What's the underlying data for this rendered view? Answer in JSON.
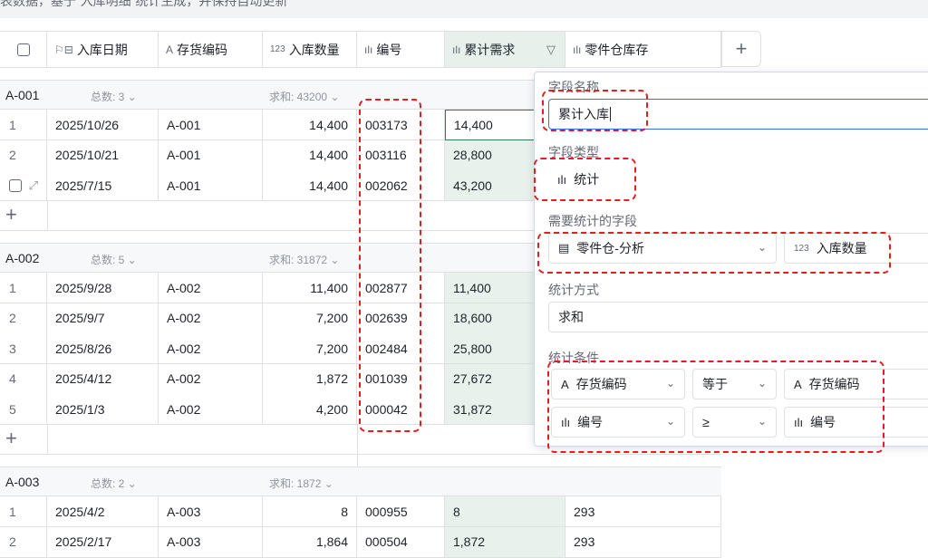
{
  "topbar": {
    "text": "表数据，基于“入库明细”统计生成，并保持自动更新"
  },
  "columns": [
    {
      "icon": "☐",
      "label": ""
    },
    {
      "icon": "⚐⧉",
      "label": "入库日期"
    },
    {
      "icon": "A̧",
      "label": "存货编码"
    },
    {
      "icon": "¹²³",
      "label": "入库数量"
    },
    {
      "icon": "ılı",
      "label": "编号"
    },
    {
      "icon": "ılı",
      "label": "累计需求",
      "filter": "⛉"
    },
    {
      "icon": "ılı",
      "label": "零件仓库存"
    }
  ],
  "add_column": "+",
  "groups": [
    {
      "title": "A-001",
      "count_label": "总数: 3",
      "sum_label": "求和: 43200",
      "rows": [
        {
          "idx": "1",
          "date": "2025/10/26",
          "code": "A-001",
          "qty": "14,400",
          "no": "003173",
          "cum": "14,400",
          "stock": ""
        },
        {
          "idx": "2",
          "date": "2025/10/21",
          "code": "A-001",
          "qty": "14,400",
          "no": "003116",
          "cum": "28,800",
          "stock": ""
        },
        {
          "idx": "",
          "date": "2025/7/15",
          "code": "A-001",
          "qty": "14,400",
          "no": "002062",
          "cum": "43,200",
          "stock": ""
        }
      ]
    },
    {
      "title": "A-002",
      "count_label": "总数: 5",
      "sum_label": "求和: 31872",
      "rows": [
        {
          "idx": "1",
          "date": "2025/9/28",
          "code": "A-002",
          "qty": "11,400",
          "no": "002877",
          "cum": "11,400",
          "stock": ""
        },
        {
          "idx": "2",
          "date": "2025/9/7",
          "code": "A-002",
          "qty": "7,200",
          "no": "002639",
          "cum": "18,600",
          "stock": ""
        },
        {
          "idx": "3",
          "date": "2025/8/26",
          "code": "A-002",
          "qty": "7,200",
          "no": "002484",
          "cum": "25,800",
          "stock": ""
        },
        {
          "idx": "4",
          "date": "2025/4/12",
          "code": "A-002",
          "qty": "1,872",
          "no": "001039",
          "cum": "27,672",
          "stock": ""
        },
        {
          "idx": "5",
          "date": "2025/1/3",
          "code": "A-002",
          "qty": "4,200",
          "no": "000042",
          "cum": "31,872",
          "stock": ""
        }
      ]
    },
    {
      "title": "A-003",
      "count_label": "总数: 2",
      "sum_label": "求和: 1872",
      "rows": [
        {
          "idx": "1",
          "date": "2025/4/2",
          "code": "A-003",
          "qty": "8",
          "no": "000955",
          "cum": "8",
          "stock": "293"
        },
        {
          "idx": "2",
          "date": "2025/2/17",
          "code": "A-003",
          "qty": "1,864",
          "no": "000504",
          "cum": "1,872",
          "stock": "293"
        }
      ]
    }
  ],
  "panel": {
    "field_name_label": "字段名称",
    "field_name_value": "累计入库",
    "field_type_label": "字段类型",
    "field_type_value": "统计",
    "stat_field_label": "需要统计的字段",
    "stat_table": "零件仓-分析",
    "stat_field": "入库数量",
    "method_label": "统计方式",
    "method_value": "求和",
    "cond_label": "统计条件",
    "conditions": [
      {
        "left": "存货编码",
        "op": "等于",
        "right": "存货编码"
      },
      {
        "left": "编号",
        "op": "≥",
        "right": "编号"
      }
    ]
  },
  "colors": {
    "accent": "#3370ff",
    "highlight": "#e02020",
    "selected_col": "#e8f1ec"
  }
}
